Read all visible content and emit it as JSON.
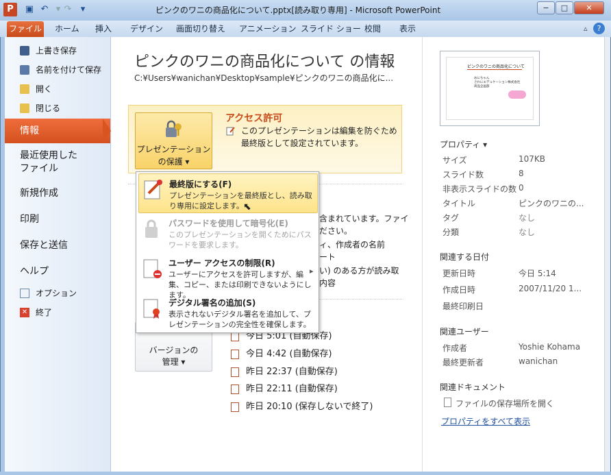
{
  "window": {
    "title": "ピンクのワニの商品化について.pptx[読み取り専用] - Microsoft PowerPoint",
    "app_icon_letter": "P",
    "minimize": "−",
    "maximize": "□",
    "close": "✕",
    "accent_color": "#d4501f"
  },
  "ribbon": {
    "tabs": [
      "ファイル",
      "ホーム",
      "挿入",
      "デザイン",
      "画面切り替え",
      "アニメーション",
      "スライド ショー",
      "校閲",
      "表示"
    ],
    "help_icon": "?"
  },
  "sidebar": {
    "small_items": [
      {
        "label": "上書き保存",
        "icon": "save-icon"
      },
      {
        "label": "名前を付けて保存",
        "icon": "save-as-icon"
      },
      {
        "label": "開く",
        "icon": "folder-open-icon"
      },
      {
        "label": "閉じる",
        "icon": "folder-close-icon"
      }
    ],
    "selected": "情報",
    "big_items": [
      "最近使用した\nファイル",
      "新規作成",
      "印刷",
      "保存と送信",
      "ヘルプ"
    ],
    "bottom_items": [
      {
        "label": "オプション",
        "icon": "options-icon"
      },
      {
        "label": "終了",
        "icon": "exit-icon"
      }
    ]
  },
  "main": {
    "title": "ピンクのワニの商品化について の情報",
    "path": "C:¥Users¥wanichan¥Desktop¥sample¥ピンクのワニの商品化に...",
    "protect_button": "プレゼンテーション\nの保護 ▾",
    "access_title": "アクセス許可",
    "access_desc": "このプレゼンテーションは編集を防ぐため最終版として設定されています。",
    "bg_texts": [
      "含まれています。ファイ",
      "ださい。",
      "ィ、作成者の名前",
      "ート",
      "い) のある方が読み取",
      "内容"
    ],
    "version_button": "バージョンの\n管理 ▾",
    "versions": [
      "今日 5:01 (自動保存)",
      "今日 4:42 (自動保存)",
      "昨日 22:37 (自動保存)",
      "昨日 22:11 (自動保存)",
      "昨日 20:10 (保存しないで終了)"
    ]
  },
  "dropdown": {
    "items": [
      {
        "title": "最終版にする(F)",
        "desc": "プレゼンテーションを最終版とし、読み取り専用に設定します。",
        "state": "hover"
      },
      {
        "title": "パスワードを使用して暗号化(E)",
        "desc": "このプレゼンテーションを開くためにパスワードを要求します。",
        "state": "disabled"
      },
      {
        "title": "ユーザー アクセスの制限(R)",
        "desc": "ユーザーにアクセスを許可しますが、編集、コピー、または印刷できないようにします。",
        "state": "normal",
        "submenu": "▸"
      },
      {
        "title": "デジタル署名の追加(S)",
        "desc": "表示されないデジタル署名を追加して、プレゼンテーションの完全性を確保します。",
        "state": "normal"
      }
    ]
  },
  "thumbnail": {
    "slide_title": "ピンクのワニの商品化について",
    "slide_body": "おにちゃん\nさわにエデュケーション株式会社\n商品企画部"
  },
  "properties": {
    "header": "プロパティ ▾",
    "rows": [
      {
        "k": "サイズ",
        "v": "107KB"
      },
      {
        "k": "スライド数",
        "v": "8"
      },
      {
        "k": "非表示スライドの数",
        "v": "0"
      },
      {
        "k": "タイトル",
        "v": "ピンクのワニの..."
      },
      {
        "k": "タグ",
        "v": "なし"
      },
      {
        "k": "分類",
        "v": "なし"
      }
    ],
    "dates_header": "関連する日付",
    "dates": [
      {
        "k": "更新日時",
        "v": "今日 5:14"
      },
      {
        "k": "作成日時",
        "v": "2007/11/20 1..."
      },
      {
        "k": "最終印刷日",
        "v": ""
      }
    ],
    "users_header": "関連ユーザー",
    "users": [
      {
        "k": "作成者",
        "v": "Yoshie Kohama"
      },
      {
        "k": "最終更新者",
        "v": "wanichan"
      }
    ],
    "docs_header": "関連ドキュメント",
    "open_location": "ファイルの保存場所を開く",
    "show_all": "プロパティをすべて表示"
  }
}
